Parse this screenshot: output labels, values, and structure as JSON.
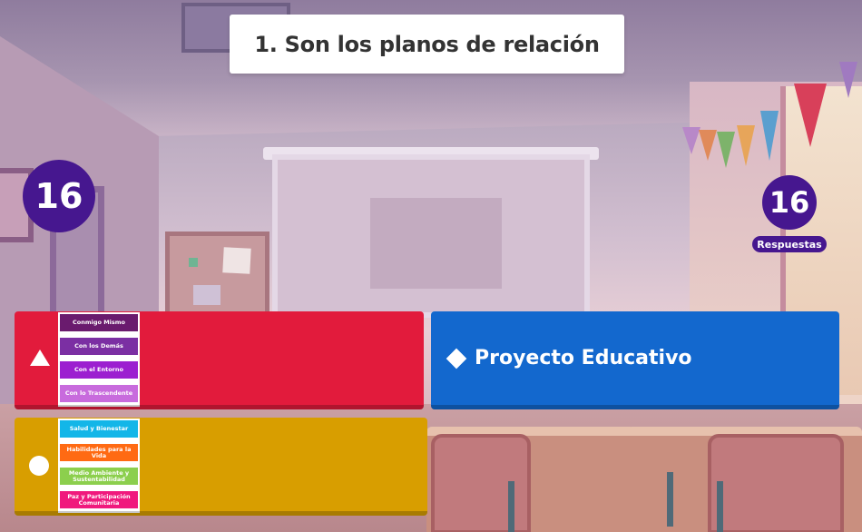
{
  "question": {
    "text": "1. Son los planos de relación"
  },
  "timer": {
    "value": "16"
  },
  "answers_count": {
    "value": "16",
    "label": "Respuestas"
  },
  "answers": [
    {
      "color": "#e21b3c",
      "shape": "triangle-icon",
      "image_chips": [
        {
          "text": "Conmigo Mismo",
          "color": "#6a1b6e"
        },
        {
          "text": "Con los Demás",
          "color": "#7b2fa3"
        },
        {
          "text": "Con el Entorno",
          "color": "#9c1fd0"
        },
        {
          "text": "Con lo Trascendente",
          "color": "#c86bdd"
        }
      ]
    },
    {
      "color": "#1368ce",
      "shape": "diamond-icon",
      "text": "Proyecto Educativo"
    },
    {
      "color": "#d89e00",
      "shape": "circle-icon",
      "image_chips": [
        {
          "text": "Salud y Bienestar",
          "color": "#13b6e8"
        },
        {
          "text": "Habilidades para la Vida",
          "color": "#ff6a13"
        },
        {
          "text": "Medio Ambiente y Sustentabilidad",
          "color": "#8ccf4d"
        },
        {
          "text": "Paz y Participación Comunitaria",
          "color": "#f0197d"
        }
      ]
    }
  ]
}
